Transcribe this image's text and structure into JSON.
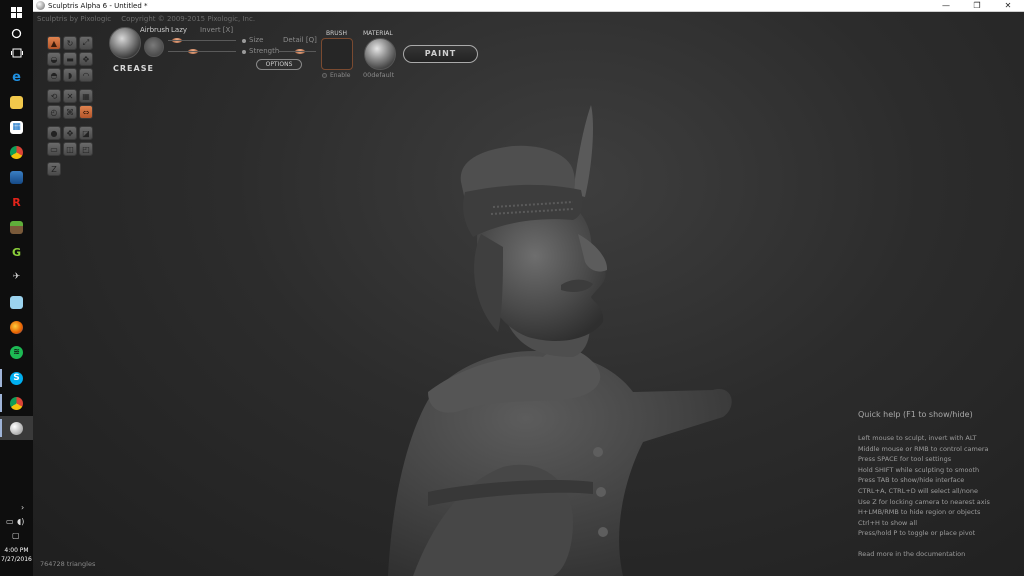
{
  "window": {
    "title": "Sculptris Alpha 6 - Untitled *",
    "minimize": "—",
    "maximize": "❐",
    "close": "✕"
  },
  "app_header": {
    "product": "Sculptris by Pixologic",
    "copyright": "Copyright © 2009-2015 Pixologic, Inc."
  },
  "brush": {
    "tool_name": "CREASE",
    "airbrush_label": "Airbrush",
    "lazy_label": "Lazy",
    "invert_label": "Invert [X]",
    "size_label": "Size",
    "strength_label": "Strength",
    "detail_label": "Detail [Q]",
    "options_label": "OPTIONS",
    "brush_section_label": "BRUSH",
    "enable_label": "Enable",
    "material_section_label": "MATERIAL",
    "material_name": "00default",
    "paint_button": "PAINT"
  },
  "quick_help": {
    "title": "Quick help (F1 to show/hide)",
    "lines": [
      "Left mouse to sculpt, invert with ALT",
      "Middle mouse or RMB to control camera",
      "Press SPACE for tool settings",
      "Hold SHIFT while sculpting to smooth",
      "Press TAB to show/hide interface",
      "CTRL+A, CTRL+D will select all/none",
      "Use Z for locking camera to nearest axis",
      "H+LMB/RMB to hide region or objects",
      "Ctrl+H to show all",
      "Press/hold P to toggle or place pivot"
    ],
    "more": "Read more in the documentation"
  },
  "status": {
    "triangle_count": "764728 triangles"
  },
  "taskbar": {
    "time": "4:00 PM",
    "date": "7/27/2016",
    "icons": [
      "windows-start-icon",
      "cortana-icon",
      "task-view-icon",
      "edge-icon",
      "file-explorer-icon",
      "store-icon",
      "chrome-icon",
      "photos-icon",
      "roblox-icon",
      "minecraft-icon",
      "green-g-icon",
      "tool-icon",
      "notepad-icon",
      "firefox-icon",
      "spotify-icon",
      "skype-icon",
      "chrome-profile-icon",
      "sculptris-icon"
    ]
  },
  "colors": {
    "accent": "#d06a38",
    "viewport_bg": "#2c2c2c",
    "model": "#4a4a4a"
  }
}
